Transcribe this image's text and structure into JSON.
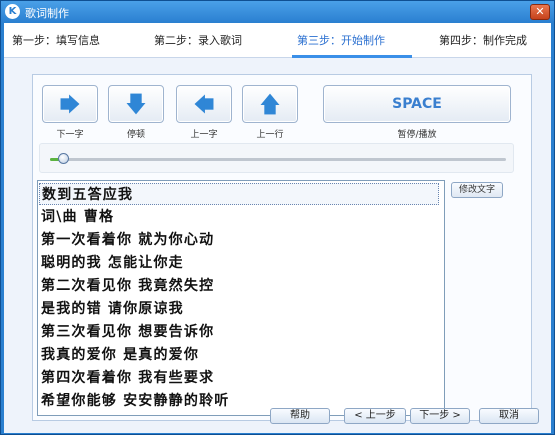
{
  "window": {
    "title": "歌词制作",
    "close_symbol": "✕",
    "app_icon_letter": "K"
  },
  "steps": [
    {
      "label": "第一步：填写信息",
      "active": false
    },
    {
      "label": "第二步：录入歌词",
      "active": false
    },
    {
      "label": "第三步：开始制作",
      "active": true
    },
    {
      "label": "第四步：制作完成",
      "active": false
    }
  ],
  "controls": {
    "next_word": {
      "label": "下一字",
      "icon": "arrow-right-icon"
    },
    "pause": {
      "label": "停顿",
      "icon": "arrow-down-icon"
    },
    "prev_word": {
      "label": "上一字",
      "icon": "arrow-left-icon"
    },
    "prev_line": {
      "label": "上一行",
      "icon": "arrow-up-icon"
    },
    "space": {
      "label": "SPACE",
      "caption": "暂停/播放"
    }
  },
  "progress": {
    "fraction": 0.03
  },
  "lyrics": [
    "数到五答应我",
    "词\\曲  曹格",
    "第一次看着你  就为你心动",
    "聪明的我  怎能让你走",
    "第二次看见你  我竟然失控",
    "是我的错  请你原谅我",
    "第三次看见你  想要告诉你",
    "我真的爱你  是真的爱你",
    "第四次看着你  我有些要求",
    "希望你能够  安安静静的聆听"
  ],
  "selected_line": 0,
  "edit_button": {
    "label": "修改文字"
  },
  "footer": {
    "help": "帮助",
    "prev": "< 上一步",
    "next": "下一步 >",
    "cancel": "取消"
  },
  "colors": {
    "accent": "#2a6fd0",
    "frame": "#2a7fcf",
    "progress": "#5bb340"
  }
}
